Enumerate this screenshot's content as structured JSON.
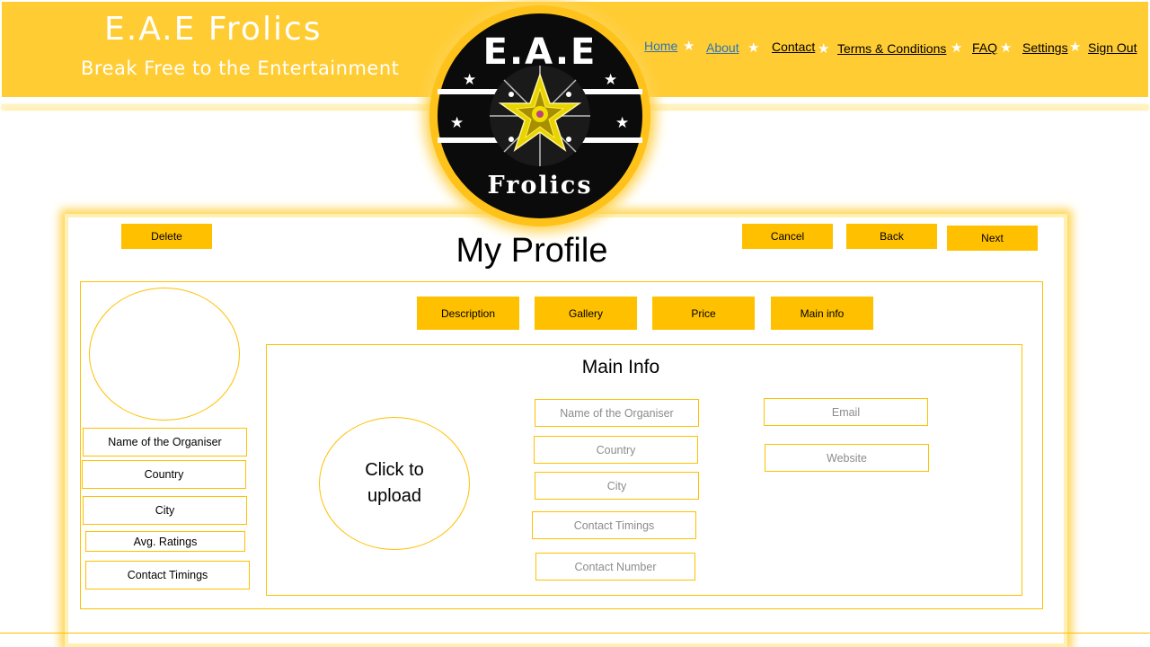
{
  "brand": {
    "title": "E.A.E Frolics",
    "tagline": "Break Free to the Entertainment"
  },
  "nav": {
    "items": [
      {
        "label": "Home"
      },
      {
        "label": "About"
      },
      {
        "label": "Contact"
      },
      {
        "label": "Terms & Conditions"
      },
      {
        "label": "FAQ"
      },
      {
        "label": "Settings"
      },
      {
        "label": "Sign Out"
      }
    ],
    "separator": "★"
  },
  "logo": {
    "top_text": "E.A.E",
    "bottom_text": "Frolics",
    "star": "★"
  },
  "page": {
    "title": "My Profile"
  },
  "actions": {
    "delete": "Delete",
    "cancel": "Cancel",
    "back": "Back",
    "next": "Next"
  },
  "tabs": [
    {
      "label": "Description"
    },
    {
      "label": "Gallery"
    },
    {
      "label": "Price"
    },
    {
      "label": "Main info"
    }
  ],
  "sidebar": {
    "fields": [
      {
        "label": "Name of the Organiser"
      },
      {
        "label": "Country"
      },
      {
        "label": "City"
      },
      {
        "label": "Avg. Ratings"
      },
      {
        "label": "Contact Timings"
      }
    ]
  },
  "main_info": {
    "title": "Main Info",
    "upload_line1": "Click to",
    "upload_line2": "upload",
    "fields_left": [
      {
        "placeholder": "Name of the Organiser"
      },
      {
        "placeholder": "Country"
      },
      {
        "placeholder": "City"
      },
      {
        "placeholder": "Contact Timings"
      },
      {
        "placeholder": "Contact Number"
      }
    ],
    "fields_right": [
      {
        "placeholder": "Email"
      },
      {
        "placeholder": "Website"
      }
    ]
  },
  "colors": {
    "header": "#ffcc33",
    "accent": "#ffc000",
    "active_link": "#2e75b6"
  }
}
